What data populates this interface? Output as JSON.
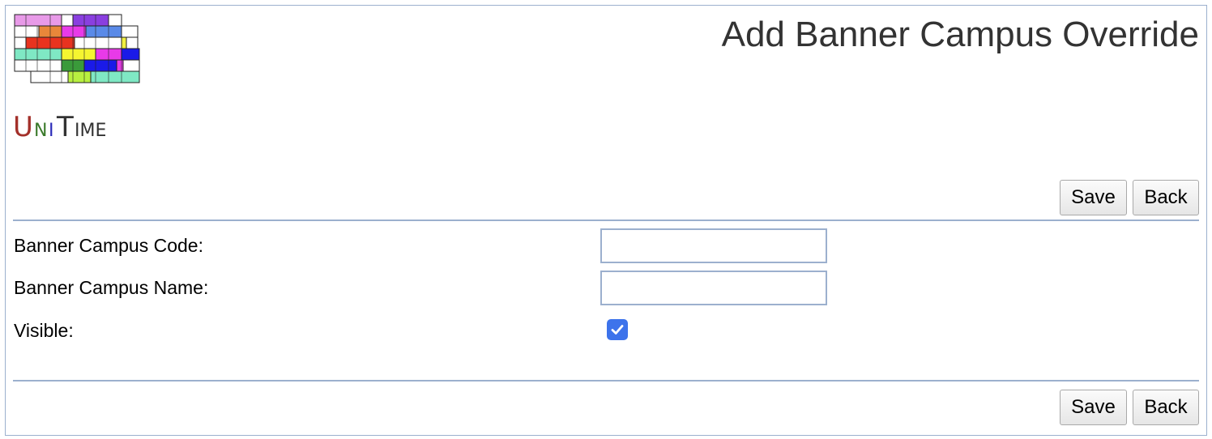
{
  "header": {
    "title": "Add Banner Campus Override",
    "logo_text": "UniTime"
  },
  "toolbar_top": {
    "save_label": "Save",
    "back_label": "Back"
  },
  "form": {
    "campus_code": {
      "label": "Banner Campus Code:",
      "value": "",
      "placeholder": ""
    },
    "campus_name": {
      "label": "Banner Campus Name:",
      "value": "",
      "placeholder": ""
    },
    "visible": {
      "label": "Visible:",
      "checked": true
    }
  },
  "toolbar_bottom": {
    "save_label": "Save",
    "back_label": "Back"
  },
  "colors": {
    "accent": "#9cb0ce",
    "checkbox": "#3d73eb",
    "title": "#333333"
  }
}
